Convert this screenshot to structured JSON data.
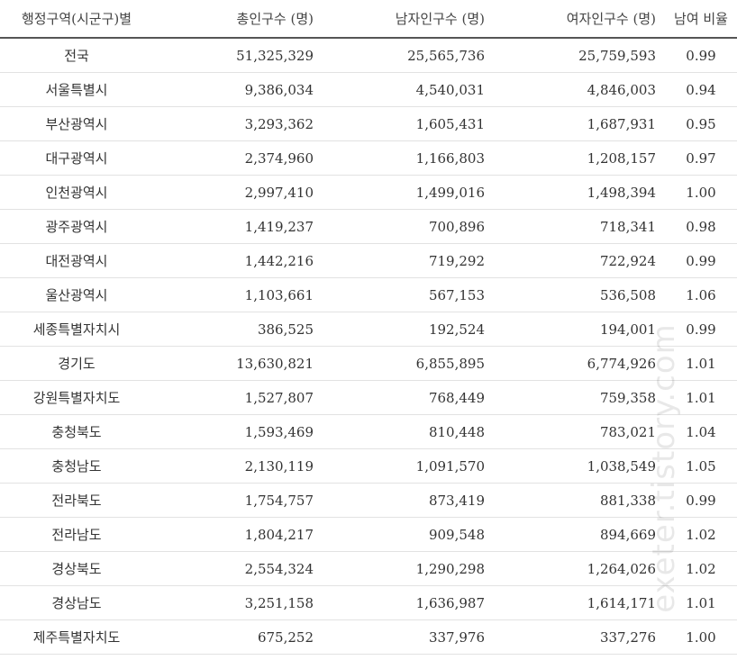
{
  "table": {
    "headers": [
      "행정구역(시군구)별",
      "총인구수 (명)",
      "남자인구수 (명)",
      "여자인구수 (명)",
      "남여 비율"
    ],
    "rows": [
      [
        "전국",
        "51,325,329",
        "25,565,736",
        "25,759,593",
        "0.99"
      ],
      [
        "서울특별시",
        "9,386,034",
        "4,540,031",
        "4,846,003",
        "0.94"
      ],
      [
        "부산광역시",
        "3,293,362",
        "1,605,431",
        "1,687,931",
        "0.95"
      ],
      [
        "대구광역시",
        "2,374,960",
        "1,166,803",
        "1,208,157",
        "0.97"
      ],
      [
        "인천광역시",
        "2,997,410",
        "1,499,016",
        "1,498,394",
        "1.00"
      ],
      [
        "광주광역시",
        "1,419,237",
        "700,896",
        "718,341",
        "0.98"
      ],
      [
        "대전광역시",
        "1,442,216",
        "719,292",
        "722,924",
        "0.99"
      ],
      [
        "울산광역시",
        "1,103,661",
        "567,153",
        "536,508",
        "1.06"
      ],
      [
        "세종특별자치시",
        "386,525",
        "192,524",
        "194,001",
        "0.99"
      ],
      [
        "경기도",
        "13,630,821",
        "6,855,895",
        "6,774,926",
        "1.01"
      ],
      [
        "강원특별자치도",
        "1,527,807",
        "768,449",
        "759,358",
        "1.01"
      ],
      [
        "충청북도",
        "1,593,469",
        "810,448",
        "783,021",
        "1.04"
      ],
      [
        "충청남도",
        "2,130,119",
        "1,091,570",
        "1,038,549",
        "1.05"
      ],
      [
        "전라북도",
        "1,754,757",
        "873,419",
        "881,338",
        "0.99"
      ],
      [
        "전라남도",
        "1,804,217",
        "909,548",
        "894,669",
        "1.02"
      ],
      [
        "경상북도",
        "2,554,324",
        "1,290,298",
        "1,264,026",
        "1.02"
      ],
      [
        "경상남도",
        "3,251,158",
        "1,636,987",
        "1,614,171",
        "1.01"
      ],
      [
        "제주특별자치도",
        "675,252",
        "337,976",
        "337,276",
        "1.00"
      ]
    ]
  },
  "watermark": "exeter.tistory.com"
}
